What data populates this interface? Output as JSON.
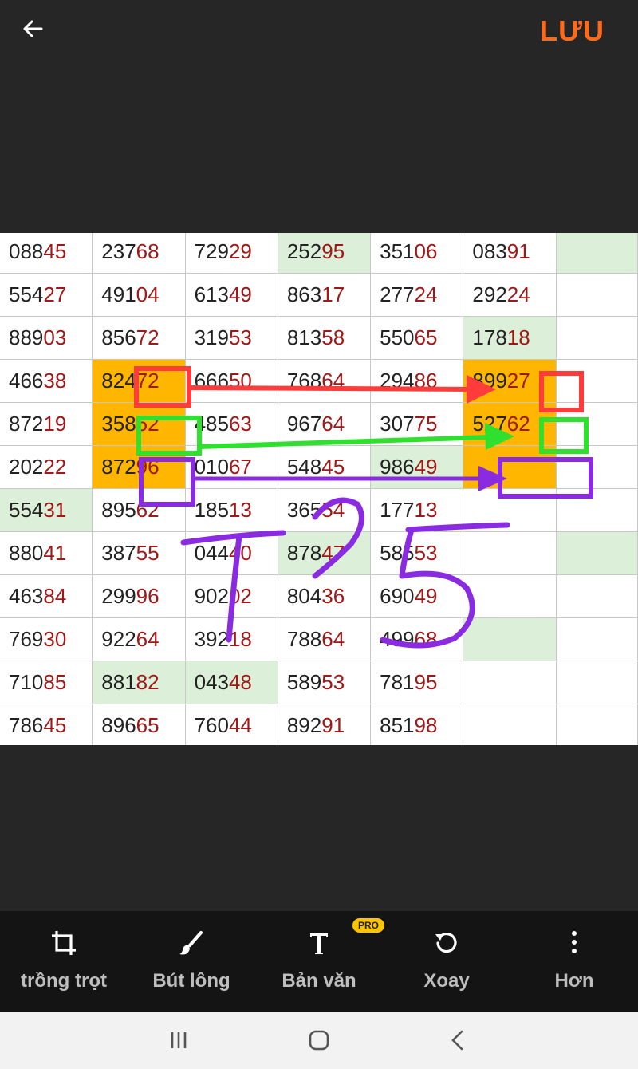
{
  "header": {
    "back_icon": "arrow-left-icon",
    "save_label": "LƯU",
    "accent_color": "#ff6a1a"
  },
  "table": {
    "rows": [
      [
        {
          "v": "08845",
          "h": ""
        },
        {
          "v": "23768",
          "h": ""
        },
        {
          "v": "72929",
          "h": ""
        },
        {
          "v": "25295",
          "h": "g"
        },
        {
          "v": "35106",
          "h": ""
        },
        {
          "v": "08391",
          "h": ""
        },
        {
          "v": "",
          "h": "g"
        }
      ],
      [
        {
          "v": "55427",
          "h": ""
        },
        {
          "v": "49104",
          "h": ""
        },
        {
          "v": "61349",
          "h": ""
        },
        {
          "v": "86317",
          "h": ""
        },
        {
          "v": "27724",
          "h": ""
        },
        {
          "v": "29224",
          "h": ""
        },
        {
          "v": "",
          "h": ""
        }
      ],
      [
        {
          "v": "88903",
          "h": ""
        },
        {
          "v": "85672",
          "h": ""
        },
        {
          "v": "31953",
          "h": ""
        },
        {
          "v": "81358",
          "h": ""
        },
        {
          "v": "55065",
          "h": ""
        },
        {
          "v": "17818",
          "h": "g"
        },
        {
          "v": "",
          "h": ""
        }
      ],
      [
        {
          "v": "46638",
          "h": ""
        },
        {
          "v": "82472",
          "h": "o"
        },
        {
          "v": "66650",
          "h": ""
        },
        {
          "v": "76864",
          "h": ""
        },
        {
          "v": "29486",
          "h": ""
        },
        {
          "v": "89927",
          "h": "o"
        },
        {
          "v": "",
          "h": ""
        }
      ],
      [
        {
          "v": "87219",
          "h": ""
        },
        {
          "v": "35862",
          "h": "o"
        },
        {
          "v": "48563",
          "h": ""
        },
        {
          "v": "96764",
          "h": ""
        },
        {
          "v": "30775",
          "h": ""
        },
        {
          "v": "52762",
          "h": "o"
        },
        {
          "v": "",
          "h": ""
        }
      ],
      [
        {
          "v": "20222",
          "h": ""
        },
        {
          "v": "87296",
          "h": "o"
        },
        {
          "v": "01067",
          "h": ""
        },
        {
          "v": "54845",
          "h": ""
        },
        {
          "v": "98649",
          "h": "g"
        },
        {
          "v": "",
          "h": "o"
        },
        {
          "v": "",
          "h": ""
        }
      ],
      [
        {
          "v": "55431",
          "h": "g"
        },
        {
          "v": "89562",
          "h": ""
        },
        {
          "v": "18513",
          "h": ""
        },
        {
          "v": "36554",
          "h": ""
        },
        {
          "v": "17713",
          "h": ""
        },
        {
          "v": "",
          "h": ""
        },
        {
          "v": "",
          "h": ""
        }
      ],
      [
        {
          "v": "88041",
          "h": ""
        },
        {
          "v": "38755",
          "h": ""
        },
        {
          "v": "04440",
          "h": ""
        },
        {
          "v": "87847",
          "h": "g"
        },
        {
          "v": "58553",
          "h": ""
        },
        {
          "v": "",
          "h": ""
        },
        {
          "v": "",
          "h": "g"
        }
      ],
      [
        {
          "v": "46384",
          "h": ""
        },
        {
          "v": "29996",
          "h": ""
        },
        {
          "v": "90202",
          "h": ""
        },
        {
          "v": "80436",
          "h": ""
        },
        {
          "v": "69049",
          "h": ""
        },
        {
          "v": "",
          "h": ""
        },
        {
          "v": "",
          "h": ""
        }
      ],
      [
        {
          "v": "76930",
          "h": ""
        },
        {
          "v": "92264",
          "h": ""
        },
        {
          "v": "39218",
          "h": ""
        },
        {
          "v": "78864",
          "h": ""
        },
        {
          "v": "49968",
          "h": ""
        },
        {
          "v": "",
          "h": "g"
        },
        {
          "v": "",
          "h": ""
        }
      ],
      [
        {
          "v": "71085",
          "h": ""
        },
        {
          "v": "88182",
          "h": "g"
        },
        {
          "v": "04348",
          "h": "g"
        },
        {
          "v": "58953",
          "h": ""
        },
        {
          "v": "78195",
          "h": ""
        },
        {
          "v": "",
          "h": ""
        },
        {
          "v": "",
          "h": ""
        }
      ],
      [
        {
          "v": "78645",
          "h": ""
        },
        {
          "v": "89665",
          "h": ""
        },
        {
          "v": "76044",
          "h": ""
        },
        {
          "v": "89291",
          "h": ""
        },
        {
          "v": "85198",
          "h": ""
        },
        {
          "v": "",
          "h": ""
        },
        {
          "v": "",
          "h": ""
        }
      ]
    ],
    "highlight_green": "#dcefd8",
    "highlight_orange": "#ffb600",
    "tail_digit_color": "#a01818"
  },
  "annotation": {
    "handwritten_text": "T25",
    "marker_colors": {
      "red": "#ff3b3b",
      "green": "#2fe02f",
      "purple": "#8a2be2"
    }
  },
  "toolbar": {
    "crop_label": "trồng trọt",
    "brush_label": "Bút lông",
    "text_label": "Bản văn",
    "text_badge": "PRO",
    "rotate_label": "Xoay",
    "more_label": "Hơn",
    "badge_color": "#ffc400"
  },
  "navbar": {
    "recent_icon": "recent-apps-icon",
    "home_icon": "home-icon",
    "back_icon": "back-chevron-icon"
  }
}
